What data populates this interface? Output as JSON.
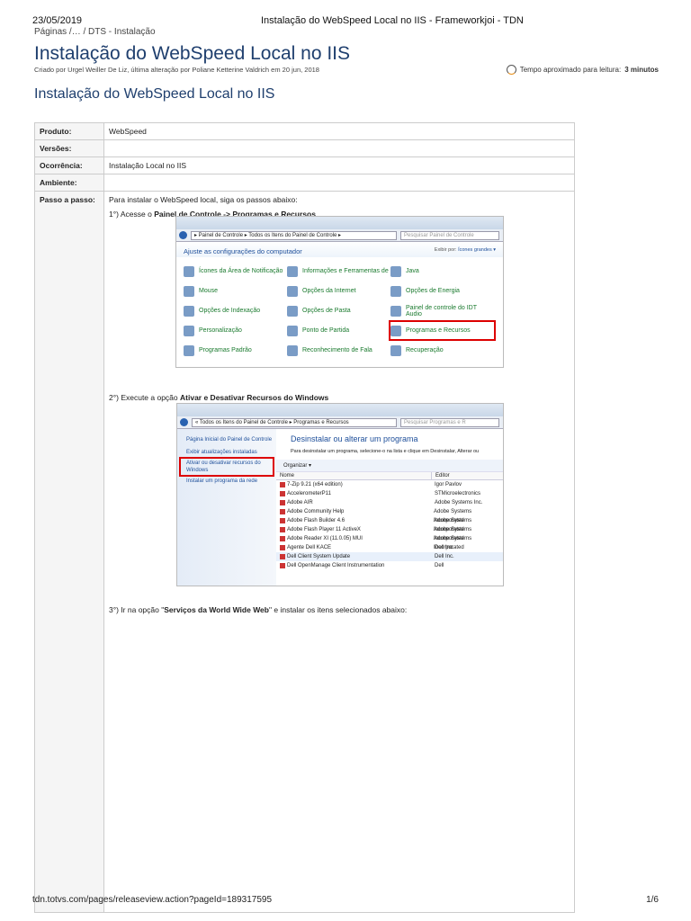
{
  "print_header": {
    "date": "23/05/2019",
    "title": "Instalação do WebSpeed Local no IIS - Frameworkjoi - TDN"
  },
  "breadcrumb": "Páginas /… / DTS - Instalação",
  "page_title": "Instalação do WebSpeed Local no IIS",
  "meta": "Criado por Urgel Weiller De Liz, última alteração por Poliane Ketterine Valdrich em 20 jun, 2018",
  "reading_time": {
    "label": "Tempo aproximado para leitura:",
    "value": "3 minutos"
  },
  "section_title": "Instalação do WebSpeed Local no IIS",
  "table": {
    "rows": [
      {
        "label": "Produto:",
        "value": "WebSpeed"
      },
      {
        "label": "Versões:",
        "value": ""
      },
      {
        "label": "Ocorrência:",
        "value": "Instalação Local no IIS"
      },
      {
        "label": "Ambiente:",
        "value": ""
      }
    ],
    "steps_label": "Passo a passo:",
    "intro": "Para instalar o WebSpeed local, siga os passos abaixo:",
    "step1": {
      "prefix": "1°) Acesse o ",
      "bold": "Painel de Controle -> Programas e Recursos"
    },
    "step2": {
      "prefix": "2°) Execute a opção ",
      "bold": "Ativar e Desativar Recursos do Windows"
    },
    "step3": {
      "prefix": "3°) Ir na opção \"",
      "bold": "Serviços da World Wide Web",
      "suffix": "\" e instalar os itens selecionados abaixo:"
    }
  },
  "shot1": {
    "address": "▸ Painel de Controle ▸ Todos os Itens do Painel de Controle ▸",
    "search": "Pesquisar Painel de Controle",
    "heading": "Ajuste as configurações do computador",
    "view_by": "Exibir por:",
    "view_value": "Ícones grandes ▾",
    "items": [
      "Ícones da Área de Notificação",
      "Informações e Ferramentas de",
      "Java",
      "Mouse",
      "Opções da Internet",
      "Opções de Energia",
      "Opções de Indexação",
      "Opções de Pasta",
      "Painel de controle do IDT Audio",
      "Personalização",
      "Ponto de Partida",
      "Programas e Recursos",
      "Programas Padrão",
      "Reconhecimento de Fala",
      "Recuperação"
    ]
  },
  "shot2": {
    "address": "« Todos os Itens do Painel de Controle ▸ Programas e Recursos",
    "search": "Pesquisar Programas e R",
    "side": [
      "Página Inicial do Painel de Controle",
      "Exibir atualizações instaladas",
      "Ativar ou desativar recursos do Windows",
      "Instalar um programa da rede"
    ],
    "heading": "Desinstalar ou alterar um programa",
    "desc": "Para desinstalar um programa, selecione-o na lista e clique em Desinstalar, Alterar ou",
    "organize": "Organizar ▾",
    "col_name": "Nome",
    "col_editor": "Editor",
    "programs": [
      [
        "7-Zip 9.21 (x64 edition)",
        "Igor Pavlov"
      ],
      [
        "AccelerometerP11",
        "STMicroelectronics"
      ],
      [
        "Adobe AIR",
        "Adobe Systems Inc."
      ],
      [
        "Adobe Community Help",
        "Adobe Systems Incorporated"
      ],
      [
        "Adobe Flash Builder 4.6",
        "Adobe Systems Incorporated"
      ],
      [
        "Adobe Flash Player 11 ActiveX",
        "Adobe Systems Incorporated"
      ],
      [
        "Adobe Reader XI (11.0.05) MUI",
        "Adobe Systems Incorporated"
      ],
      [
        "Agente Dell KACE",
        "Dell Inc."
      ],
      [
        "Dell Client System Update",
        "Dell Inc."
      ],
      [
        "Dell OpenManage Client Instrumentation",
        "Dell"
      ]
    ]
  },
  "print_footer": {
    "url": "tdn.totvs.com/pages/releaseview.action?pageId=189317595",
    "page": "1/6"
  }
}
